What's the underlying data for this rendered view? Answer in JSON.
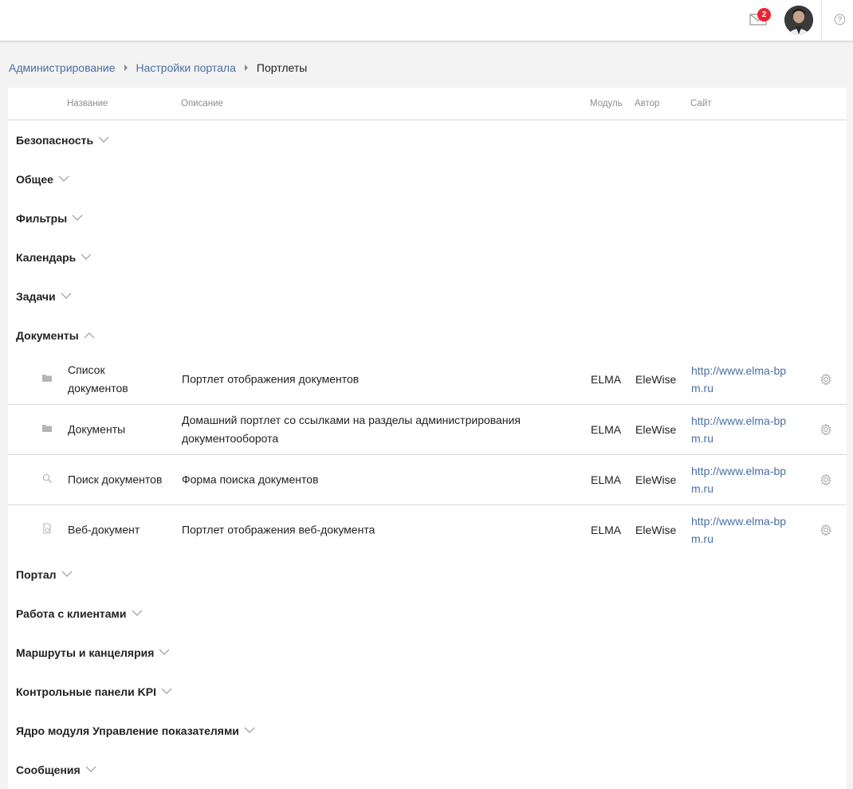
{
  "header": {
    "mail_badge": "2",
    "icons": {
      "mail": "envelope-icon",
      "help": "question-circle-icon"
    }
  },
  "breadcrumb": {
    "items": [
      "Администрирование",
      "Настройки портала"
    ],
    "current": "Портлеты"
  },
  "table": {
    "columns": {
      "name": "Название",
      "description": "Описание",
      "module": "Модуль",
      "author": "Автор",
      "site": "Сайт"
    },
    "groups_before": [
      "Безопасность",
      "Общее",
      "Фильтры",
      "Календарь",
      "Задачи"
    ],
    "expanded_group": "Документы",
    "rows": [
      {
        "name": "Список документов",
        "description": "Портлет отображения документов",
        "module": "ELMA",
        "author": "EleWise",
        "site": "http://www.elma-bpm.ru",
        "icon": "folder-icon"
      },
      {
        "name": "Документы",
        "description": "Домашний портлет со ссылками на разделы администрирования документооборота",
        "module": "ELMA",
        "author": "EleWise",
        "site": "http://www.elma-bpm.ru",
        "icon": "folder-icon"
      },
      {
        "name": "Поиск документов",
        "description": "Форма поиска документов",
        "module": "ELMA",
        "author": "EleWise",
        "site": "http://www.elma-bpm.ru",
        "icon": "search-icon"
      },
      {
        "name": "Веб-документ",
        "description": "Портлет отображения веб-документа",
        "module": "ELMA",
        "author": "EleWise",
        "site": "http://www.elma-bpm.ru",
        "icon": "web-document-icon"
      }
    ],
    "groups_after": [
      "Портал",
      "Работа с клиентами",
      "Маршруты и канцелярия",
      "Контрольные панели KPI",
      "Ядро модуля Управление показателями",
      "Сообщения"
    ]
  },
  "colors": {
    "link": "#4a6fa5",
    "badge": "#e22233"
  }
}
